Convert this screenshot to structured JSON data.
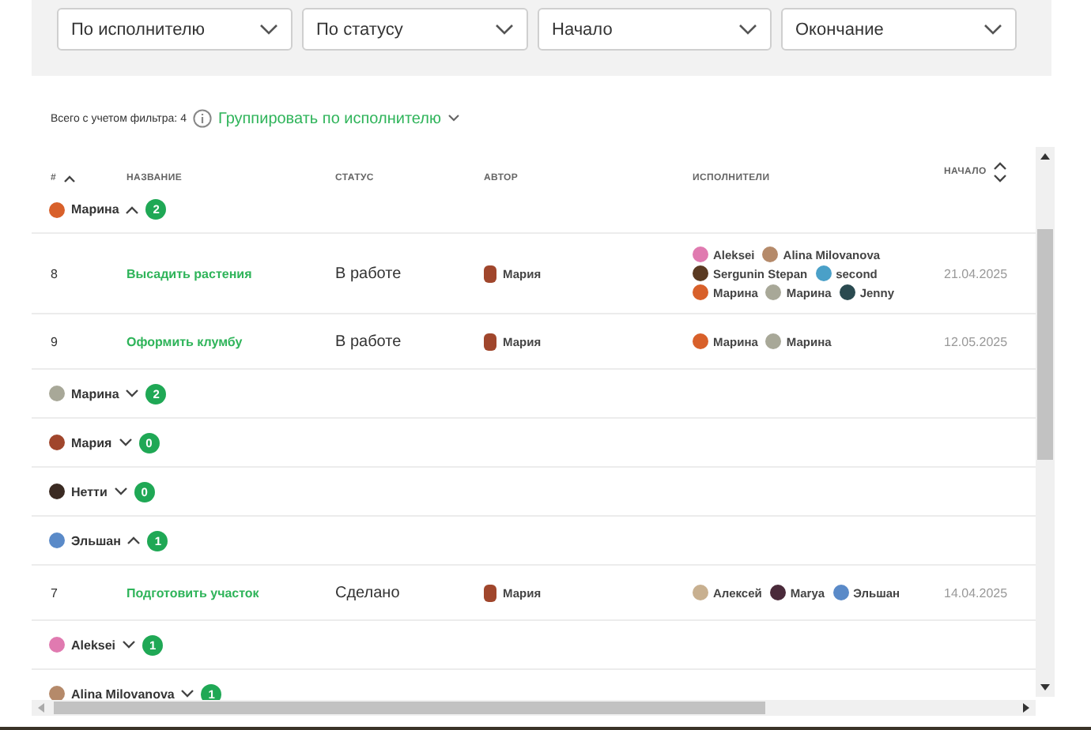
{
  "filters": [
    {
      "placeholder": "По исполнителю"
    },
    {
      "placeholder": "По статусу"
    },
    {
      "placeholder": "Начало"
    },
    {
      "placeholder": "Окончание"
    }
  ],
  "summary": {
    "label": "Всего с учетом фильтра: 4",
    "group_by": "Группировать по исполнителю"
  },
  "table": {
    "columns": [
      {
        "label": "#",
        "kind": "sorted"
      },
      {
        "label": "НАЗВАНИЕ",
        "kind": "plain"
      },
      {
        "label": "СТАТУС",
        "kind": "plain"
      },
      {
        "label": "АВТОР",
        "kind": "plain"
      },
      {
        "label": "ИСПОЛНИТЕЛИ",
        "kind": "plain"
      },
      {
        "label": "НАЧАЛО",
        "kind": "sortable"
      }
    ],
    "groups": [
      {
        "name": "Марина",
        "color": "#d8602a",
        "expanded": true,
        "count": "2",
        "tasks": [
          {
            "id": "8",
            "title": "Высадить растения",
            "status": "В работе",
            "author": {
              "name": "Мария",
              "color": "#a0462c"
            },
            "assignees": [
              {
                "name": "Aleksei",
                "color": "#e07ab0"
              },
              {
                "name": "Alina Milovanova",
                "color": "#b58a6a"
              },
              {
                "name": "Sergunin Stepan",
                "color": "#5a3a22"
              },
              {
                "name": "second",
                "color": "#4aa0c8"
              },
              {
                "name": "Марина",
                "color": "#d8602a"
              },
              {
                "name": "Марина",
                "color": "#a8a898"
              },
              {
                "name": "Jenny",
                "color": "#2a4a50"
              }
            ],
            "start": "21.04.2025"
          },
          {
            "id": "9",
            "title": "Оформить клумбу",
            "status": "В работе",
            "author": {
              "name": "Мария",
              "color": "#a0462c"
            },
            "assignees": [
              {
                "name": "Марина",
                "color": "#d8602a"
              },
              {
                "name": "Марина",
                "color": "#a8a898"
              }
            ],
            "start": "12.05.2025"
          }
        ]
      },
      {
        "name": "Марина",
        "color": "#a8a898",
        "expanded": false,
        "count": "2"
      },
      {
        "name": "Мария",
        "color": "#a0462c",
        "expanded": false,
        "count": "0"
      },
      {
        "name": "Нетти",
        "color": "#3a2a22",
        "expanded": false,
        "count": "0"
      },
      {
        "name": "Эльшан",
        "color": "#5a8ac8",
        "expanded": true,
        "count": "1",
        "tasks": [
          {
            "id": "7",
            "title": "Подготовить участок",
            "status": "Сделано",
            "author": {
              "name": "Мария",
              "color": "#a0462c"
            },
            "assignees": [
              {
                "name": "Алексей",
                "color": "#c8b090"
              },
              {
                "name": "Marya",
                "color": "#4a2a3a"
              },
              {
                "name": "Эльшан",
                "color": "#5a8ac8"
              }
            ],
            "start": "14.04.2025"
          }
        ]
      },
      {
        "name": "Aleksei",
        "color": "#e07ab0",
        "expanded": false,
        "count": "1"
      },
      {
        "name": "Alina Milovanova",
        "color": "#b58a6a",
        "expanded": false,
        "count": "1"
      }
    ]
  }
}
